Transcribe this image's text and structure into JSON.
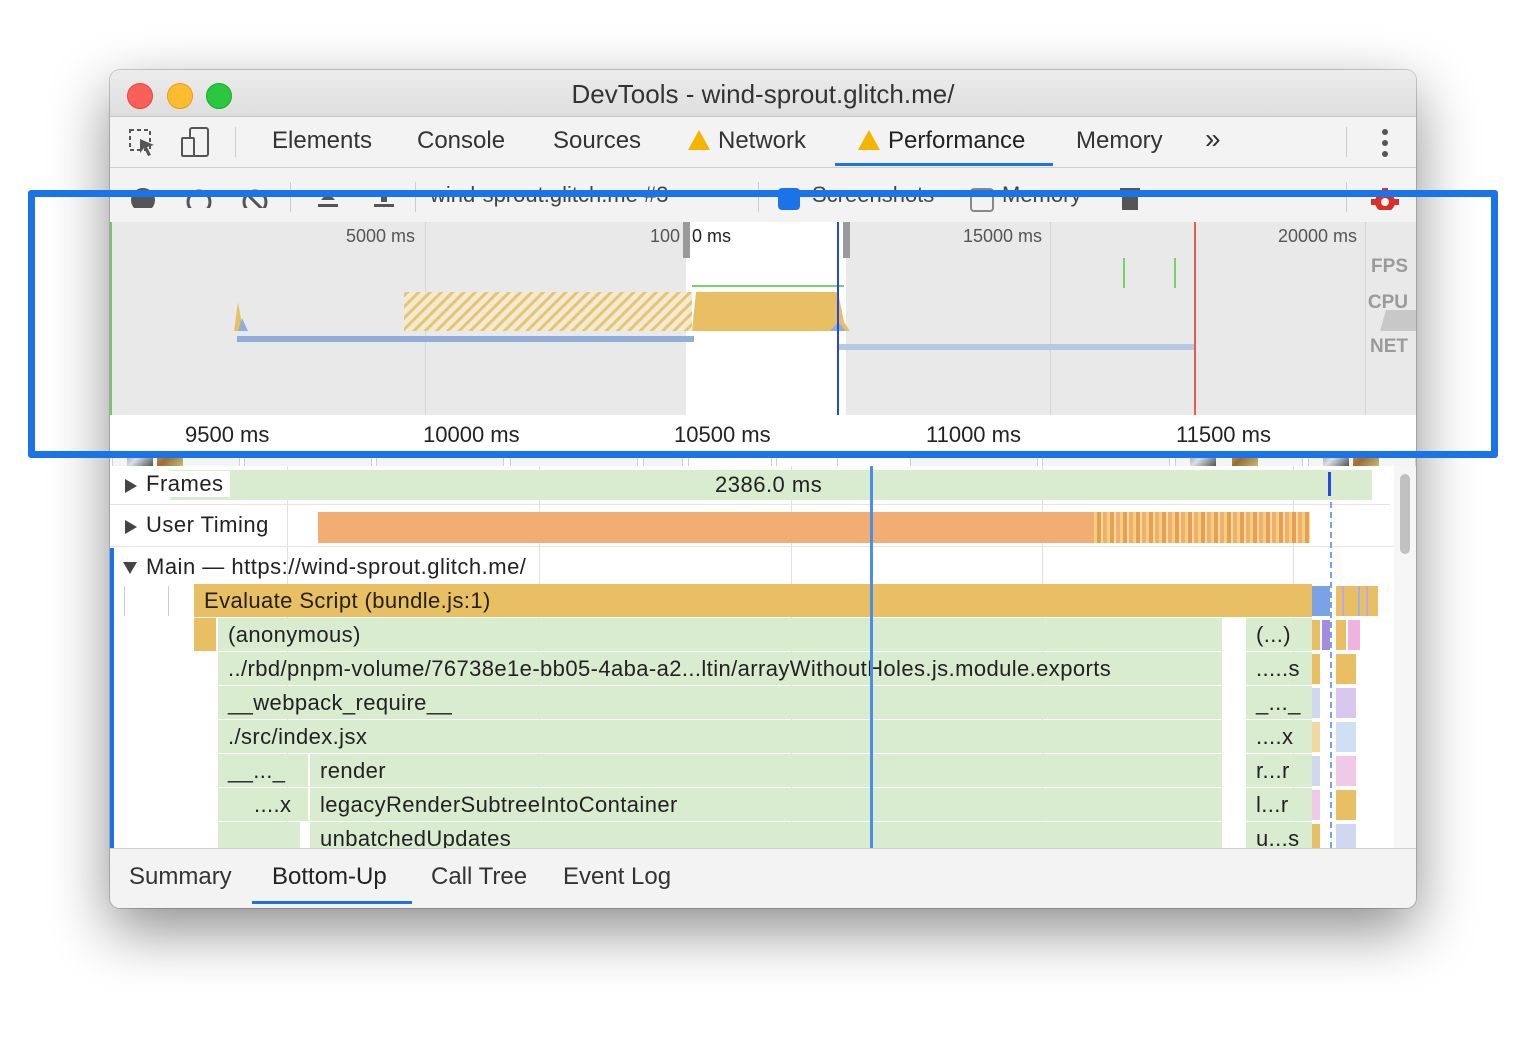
{
  "window": {
    "title": "DevTools - wind-sprout.glitch.me/"
  },
  "tabs": {
    "items": [
      {
        "label": "Elements"
      },
      {
        "label": "Console"
      },
      {
        "label": "Sources"
      },
      {
        "label": "Network",
        "warning": true
      },
      {
        "label": "Performance",
        "warning": true,
        "active": true
      },
      {
        "label": "Memory"
      }
    ],
    "more": "»"
  },
  "toolbar": {
    "recording_select": "wind-sprout.glitch.me #3",
    "screenshots_label": "Screenshots",
    "screenshots_checked": true,
    "memory_label": "Memory",
    "memory_checked": false
  },
  "overview": {
    "time_labels": [
      "5000 ms",
      "10000 ms",
      "15000 ms",
      "20000 ms"
    ],
    "track_labels": [
      "FPS",
      "CPU",
      "NET"
    ]
  },
  "ruler": {
    "labels": [
      "9500 ms",
      "10000 ms",
      "10500 ms",
      "11000 ms",
      "11500 ms"
    ]
  },
  "tracks": {
    "frames": {
      "label": "Frames",
      "duration": "2386.0 ms"
    },
    "user_timing": {
      "label": "User Timing"
    },
    "main": {
      "label": "Main — https://wind-sprout.glitch.me/"
    }
  },
  "flame": [
    {
      "label": "Evaluate Script (bundle.js:1)",
      "right": ""
    },
    {
      "label": "(anonymous)",
      "right": "(...)"
    },
    {
      "label": "../rbd/pnpm-volume/76738e1e-bb05-4aba-a2...ltin/arrayWithoutHoles.js.module.exports",
      "right": ".....s"
    },
    {
      "label": "__webpack_require__",
      "right": "_..._"
    },
    {
      "label": "./src/index.jsx",
      "right": "....x"
    },
    {
      "label": "render",
      "prefix": "__..._",
      "right": "r...r"
    },
    {
      "label": "legacyRenderSubtreeIntoContainer",
      "prefix": "....x",
      "right": "l...r"
    },
    {
      "label": "unbatchedUpdates",
      "right": "u...s"
    }
  ],
  "bottom_tabs": [
    "Summary",
    "Bottom-Up",
    "Call Tree",
    "Event Log"
  ],
  "colors": {
    "accent": "#1a73e8",
    "script_yellow": "#e8c063",
    "frames_green": "#d9ecd0",
    "user_timing_orange": "#f2ae72",
    "warning": "#f4b400"
  }
}
